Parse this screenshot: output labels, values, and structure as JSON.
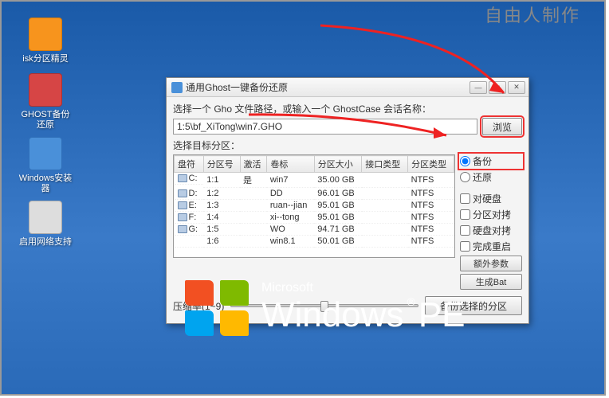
{
  "corner_text": "自由人制作",
  "desktop_icons": [
    {
      "label": "isk分区精灵"
    },
    {
      "label": "GHOST备份还原"
    },
    {
      "label": "Windows安装器"
    },
    {
      "label": "启用网络支持"
    }
  ],
  "dialog": {
    "title": "通用Ghost一键备份还原",
    "label_path": "选择一个 Gho 文件路径，或输入一个 GhostCase 会话名称：",
    "path_value": "1:5\\bf_XiTong\\win7.GHO",
    "browse_btn": "浏览",
    "label_target": "选择目标分区：",
    "table": {
      "headers": [
        "盘符",
        "分区号",
        "激活",
        "卷标",
        "分区大小",
        "接口类型",
        "分区类型"
      ],
      "rows": [
        [
          "C:",
          "1:1",
          "是",
          "win7",
          "35.00 GB",
          "",
          "NTFS"
        ],
        [
          "D:",
          "1:2",
          "",
          "DD",
          "96.01 GB",
          "",
          "NTFS"
        ],
        [
          "E:",
          "1:3",
          "",
          "ruan--jian",
          "95.01 GB",
          "",
          "NTFS"
        ],
        [
          "F:",
          "1:4",
          "",
          "xi--tong",
          "95.01 GB",
          "",
          "NTFS"
        ],
        [
          "G:",
          "1:5",
          "",
          "WO",
          "94.71 GB",
          "",
          "NTFS"
        ],
        [
          "",
          "1:6",
          "",
          "win8.1",
          "50.01 GB",
          "",
          "NTFS"
        ]
      ]
    },
    "radio_backup": "备份",
    "radio_restore": "还原",
    "chk_disk": "对硬盘",
    "chk_compare": "分区对拷",
    "chk_diskcompare": "硬盘对拷",
    "chk_reboot": "完成重启",
    "btn_extra": "额外参数",
    "btn_genbat": "生成Bat",
    "slider_label": "压缩率(1~9)",
    "bottom_btn": "备份选择的分区"
  },
  "pe": {
    "ms": "Microsoft",
    "win": "Windows",
    "pe": "PE",
    "reg": "®"
  }
}
